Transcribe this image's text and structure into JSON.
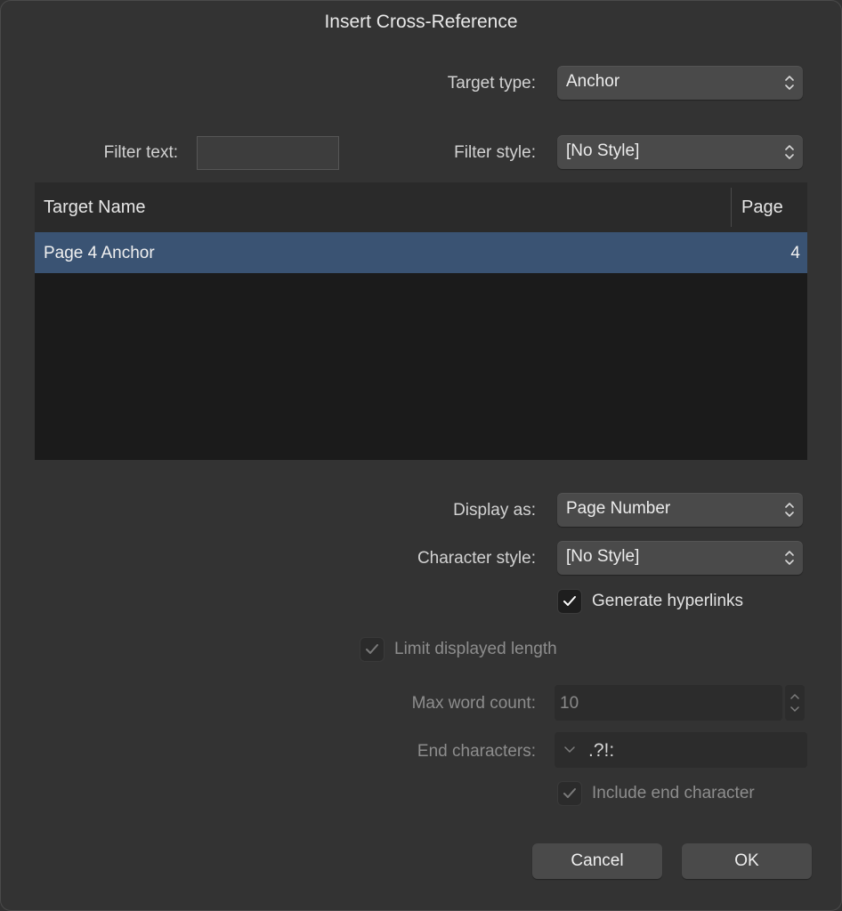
{
  "dialog": {
    "title": "Insert Cross-Reference"
  },
  "target_type": {
    "label": "Target type:",
    "value": "Anchor"
  },
  "filter_text": {
    "label": "Filter text:",
    "value": ""
  },
  "filter_style": {
    "label": "Filter style:",
    "value": "[No Style]"
  },
  "table": {
    "columns": [
      "Target Name",
      "Page"
    ],
    "rows": [
      {
        "name": "Page 4 Anchor",
        "page": "4",
        "selected": true
      }
    ]
  },
  "display_as": {
    "label": "Display as:",
    "value": "Page Number"
  },
  "character_style": {
    "label": "Character style:",
    "value": "[No Style]"
  },
  "generate_hyperlinks": {
    "label": "Generate hyperlinks",
    "checked": true
  },
  "limit_length": {
    "label": "Limit displayed length",
    "checked": true,
    "enabled": false
  },
  "max_word_count": {
    "label": "Max word count:",
    "value": "10"
  },
  "end_characters": {
    "label": "End characters:",
    "value": ".?!:"
  },
  "include_end_character": {
    "label": "Include end character",
    "checked": true,
    "enabled": false
  },
  "buttons": {
    "cancel": "Cancel",
    "ok": "OK"
  },
  "icons": {
    "popup": "chevron-updown-icon",
    "check": "checkmark-icon",
    "stepper": "stepper-icon",
    "dropdown": "chevron-down-icon"
  },
  "colors": {
    "selection": "#3a5373",
    "background": "#333333"
  }
}
